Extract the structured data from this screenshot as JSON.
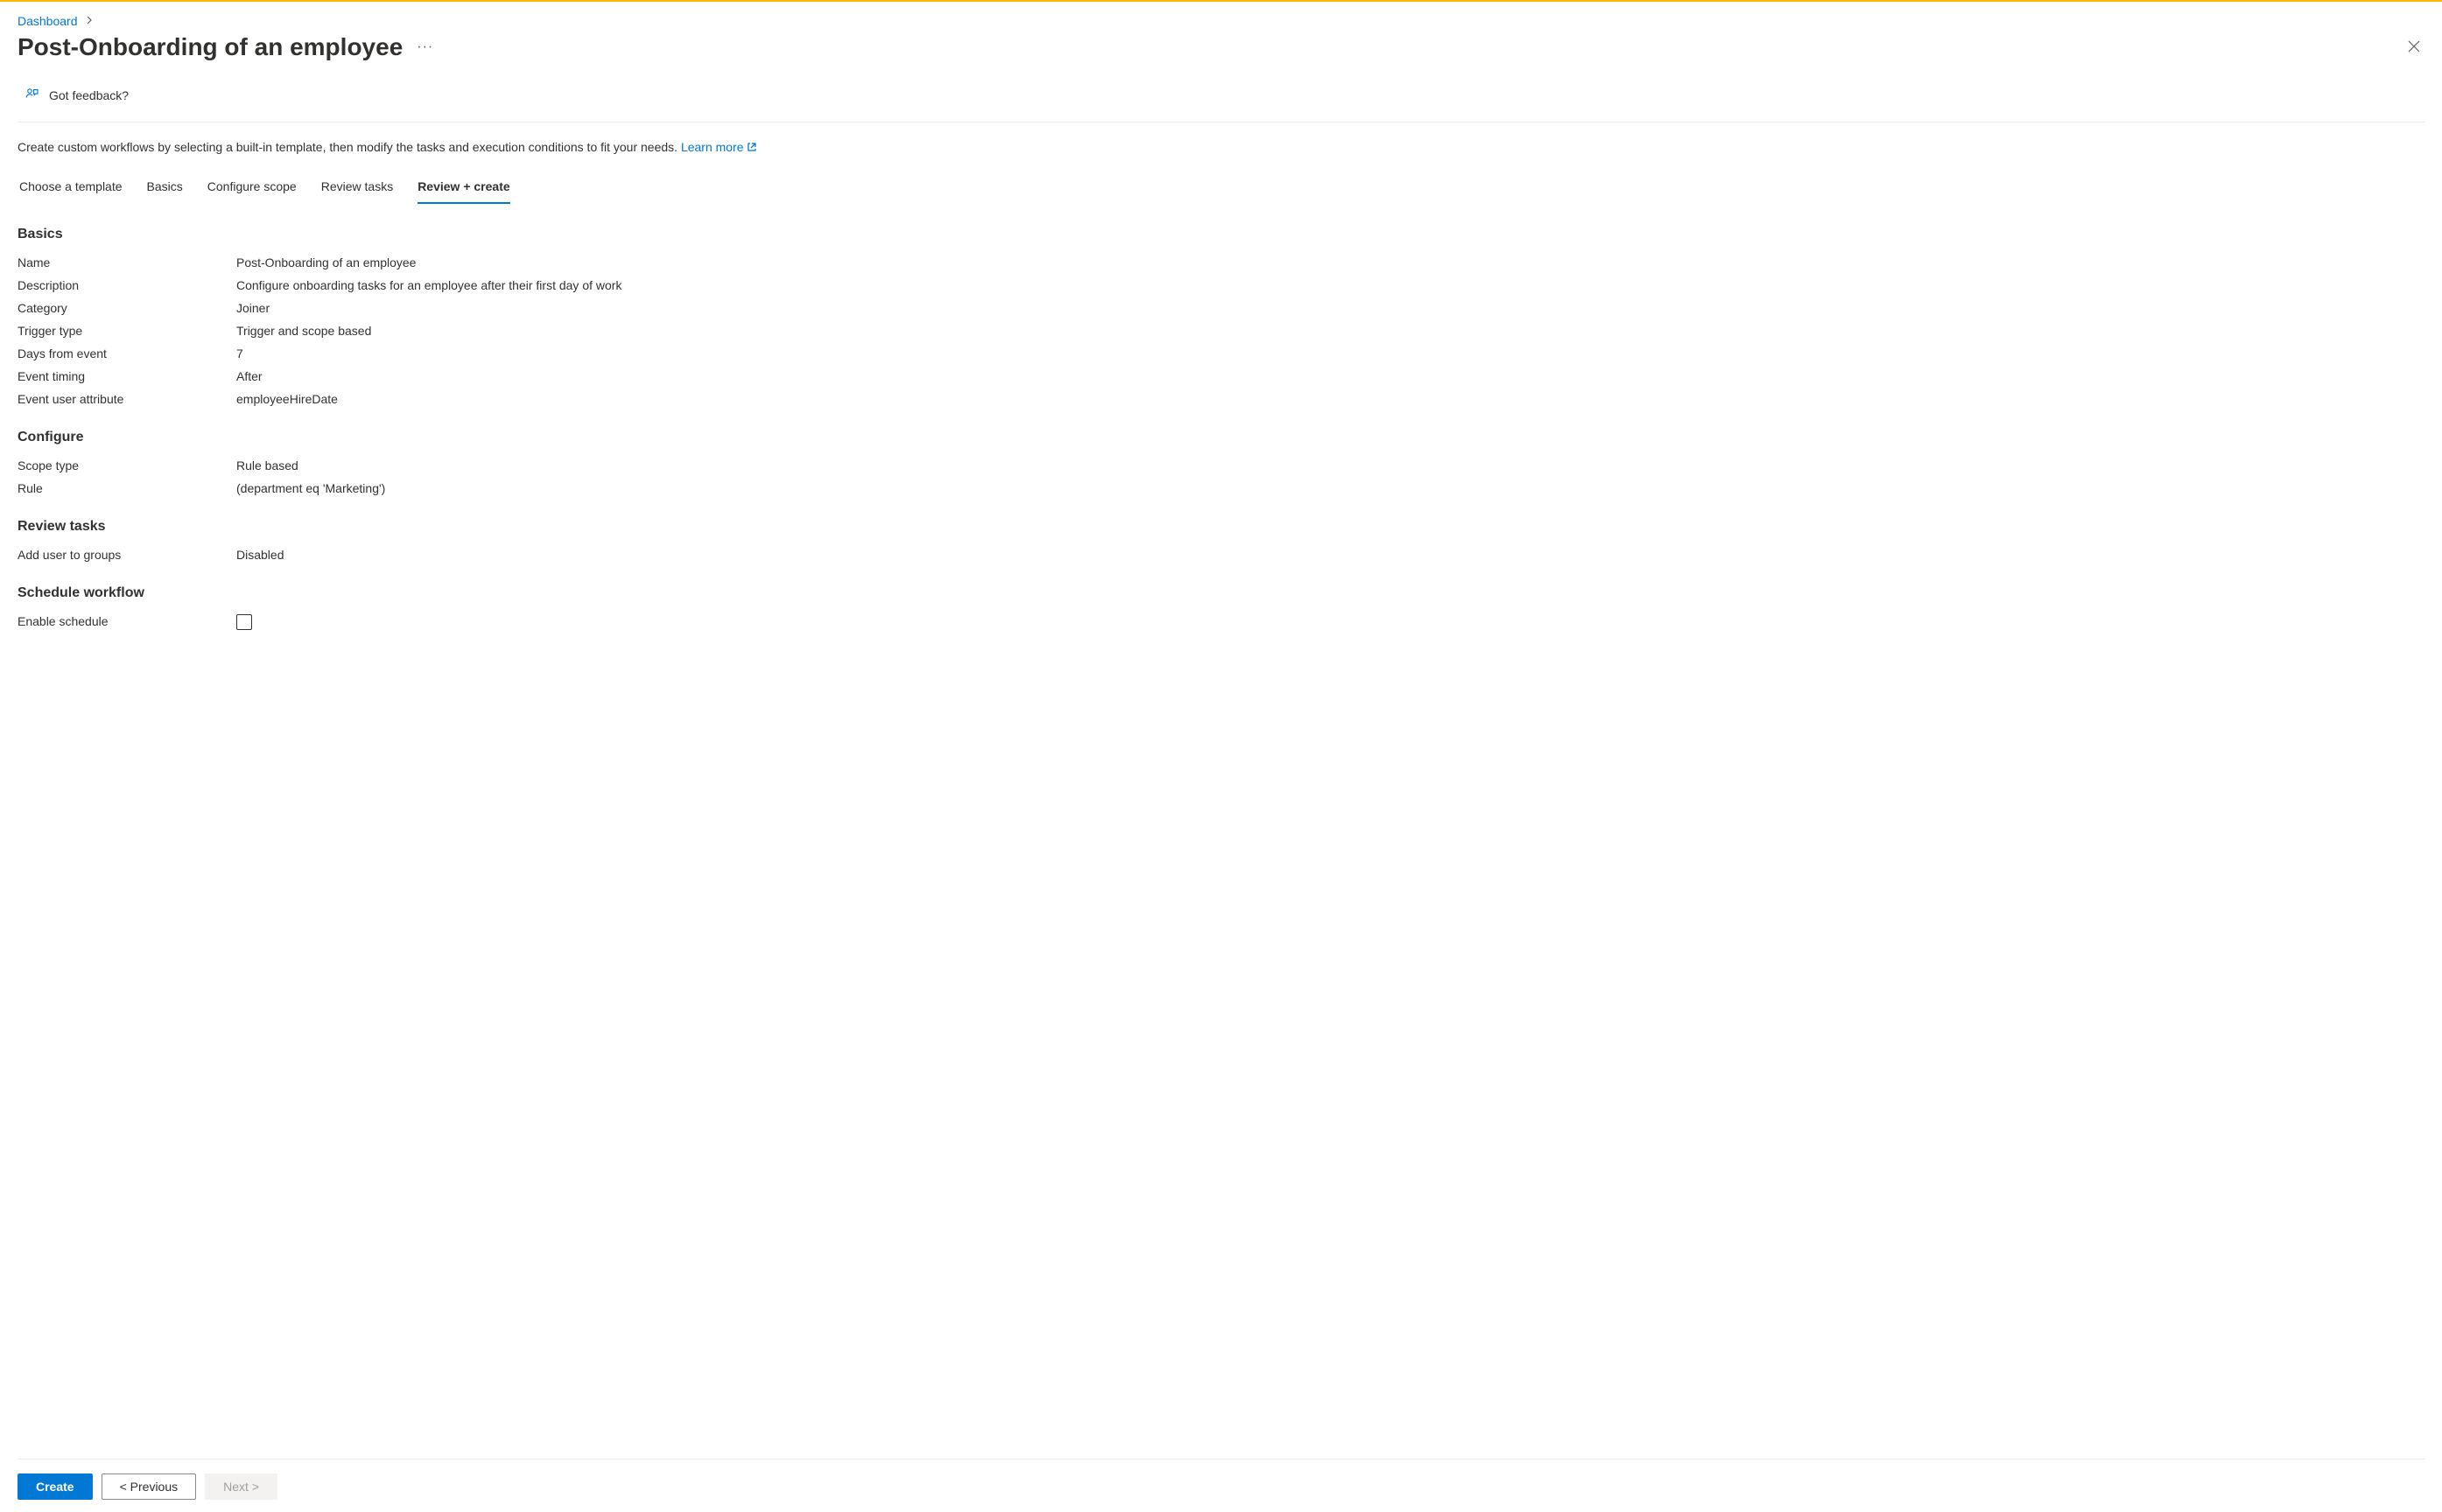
{
  "breadcrumb": {
    "dashboard": "Dashboard"
  },
  "header": {
    "title": "Post-Onboarding of an employee",
    "feedback": "Got feedback?"
  },
  "intro": {
    "text": "Create custom workflows by selecting a built-in template, then modify the tasks and execution conditions to fit your needs. ",
    "learnMore": "Learn more"
  },
  "tabs": {
    "chooseTemplate": "Choose a template",
    "basics": "Basics",
    "configureScope": "Configure scope",
    "reviewTasks": "Review tasks",
    "reviewCreate": "Review + create"
  },
  "sections": {
    "basics": {
      "heading": "Basics",
      "rows": {
        "name": {
          "label": "Name",
          "value": "Post-Onboarding of an employee"
        },
        "description": {
          "label": "Description",
          "value": "Configure onboarding tasks for an employee after their first day of work"
        },
        "category": {
          "label": "Category",
          "value": "Joiner"
        },
        "triggerType": {
          "label": "Trigger type",
          "value": "Trigger and scope based"
        },
        "daysFromEvent": {
          "label": "Days from event",
          "value": "7"
        },
        "eventTiming": {
          "label": "Event timing",
          "value": "After"
        },
        "eventUserAttribute": {
          "label": "Event user attribute",
          "value": "employeeHireDate"
        }
      }
    },
    "configure": {
      "heading": "Configure",
      "rows": {
        "scopeType": {
          "label": "Scope type",
          "value": "Rule based"
        },
        "rule": {
          "label": "Rule",
          "value": "(department eq 'Marketing')"
        }
      }
    },
    "reviewTasks": {
      "heading": "Review tasks",
      "rows": {
        "addUserToGroups": {
          "label": "Add user to groups",
          "value": "Disabled"
        }
      }
    },
    "scheduleWorkflow": {
      "heading": "Schedule workflow",
      "rows": {
        "enableSchedule": {
          "label": "Enable schedule"
        }
      }
    }
  },
  "footer": {
    "create": "Create",
    "previous": "<  Previous",
    "next": "Next  >"
  }
}
